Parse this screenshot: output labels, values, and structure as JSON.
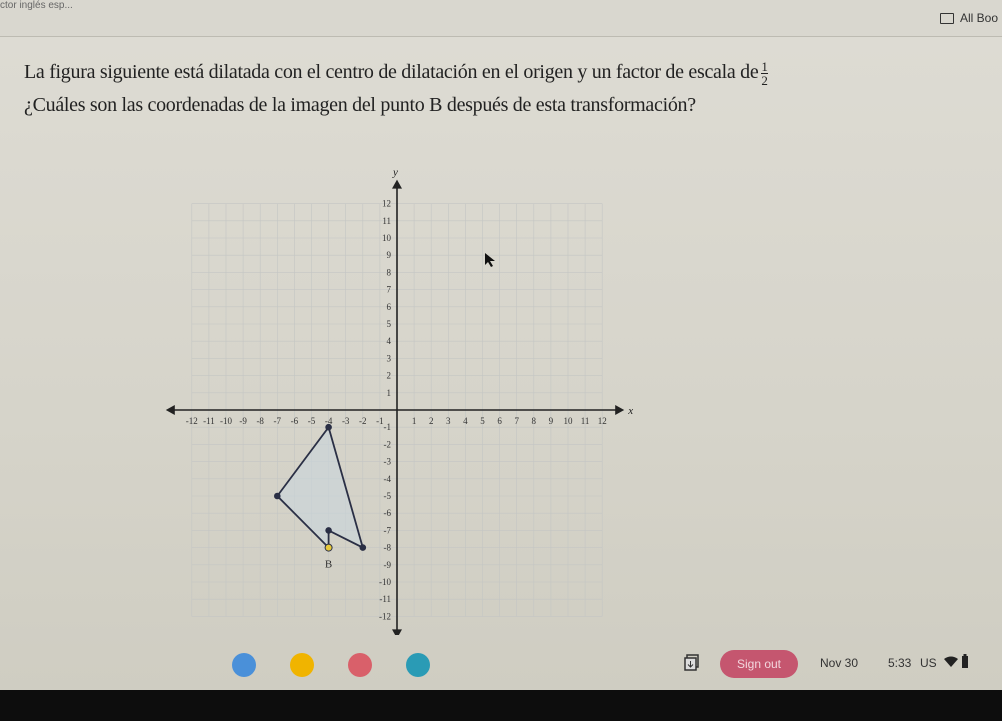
{
  "browser": {
    "tab_title": "ctor inglés esp...",
    "bookmarks_label": "All Boo"
  },
  "question": {
    "line1": "La figura siguiente está dilatada con el centro de dilatación en el origen y un factor de escala de",
    "fraction": {
      "numerator": "1",
      "denominator": "2"
    },
    "line2": "¿Cuáles son las coordenadas de la imagen del punto B después de esta transformación?"
  },
  "graph": {
    "x_axis_label": "x",
    "y_axis_label": "y",
    "range": [
      -12,
      12
    ],
    "polygon": [
      [
        -4,
        -1
      ],
      [
        -2,
        -8
      ],
      [
        -4,
        -7
      ],
      [
        -4,
        -8
      ],
      [
        -7,
        -5
      ]
    ],
    "point_B": {
      "label": "B",
      "x": -4,
      "y": -8,
      "color": "#e8c93a"
    },
    "fill_color": "#c9d6dc",
    "line_color": "#2a2f45"
  },
  "shelf": {
    "apps": [
      {
        "name": "chrome-icon",
        "color": "#4a90d9"
      },
      {
        "name": "drive-icon",
        "color": "#f0b400"
      },
      {
        "name": "app-red-icon",
        "color": "#d9606a"
      },
      {
        "name": "classroom-icon",
        "color": "#2a9bb5"
      }
    ],
    "sign_out_label": "Sign out",
    "date": "Nov 30",
    "time": "5:33",
    "locale": "US"
  }
}
